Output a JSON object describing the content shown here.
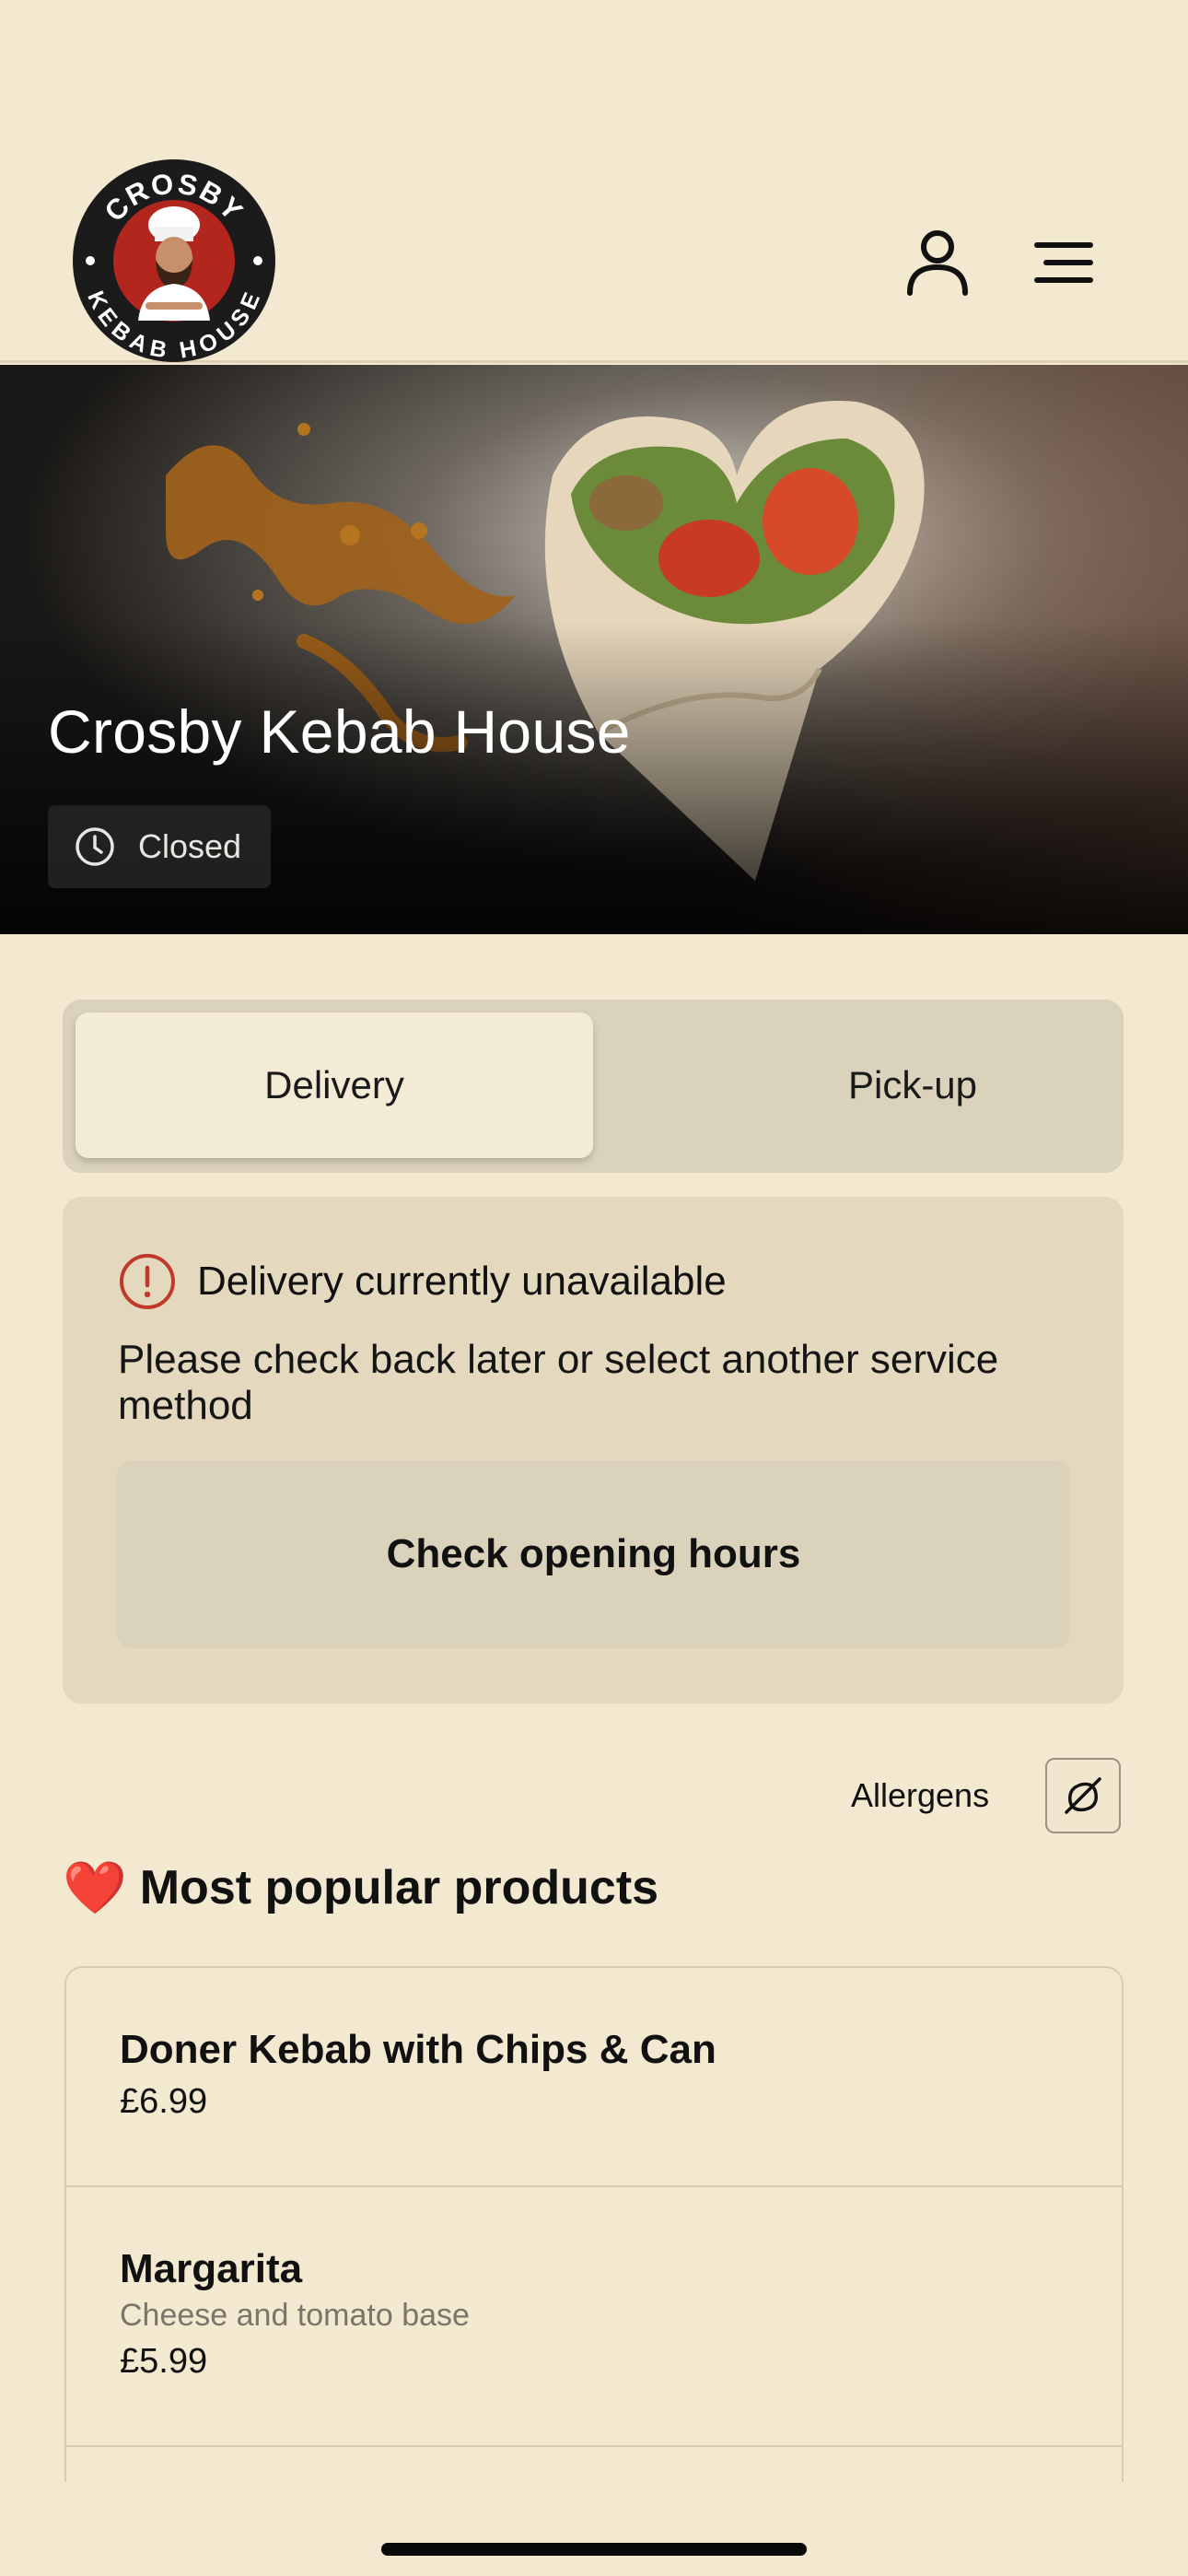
{
  "header": {
    "logo_text_top": "CROSBY",
    "logo_text_bottom": "KEBAB HOUSE",
    "icons": {
      "account": "user-icon",
      "menu": "hamburger-menu-icon"
    }
  },
  "hero": {
    "title": "Crosby Kebab House",
    "status": "Closed",
    "status_icon": "clock-icon"
  },
  "service": {
    "options": [
      "Delivery",
      "Pick-up"
    ],
    "selected": "Delivery"
  },
  "notice": {
    "icon": "info-circle-icon",
    "title": "Delivery currently unavailable",
    "message": "Please check back later or select another service method",
    "button_label": "Check opening hours"
  },
  "allergens": {
    "label": "Allergens",
    "icon": "allergen-icon"
  },
  "popular": {
    "emoji": "❤️",
    "title": "Most popular products",
    "products": [
      {
        "name": "Doner Kebab with Chips & Can",
        "description": "",
        "price": "£6.99"
      },
      {
        "name": "Margarita",
        "description": "Cheese and tomato base",
        "price": "£5.99"
      }
    ]
  },
  "colors": {
    "background": "#f3e9d1",
    "toggle_bg": "#dbd2bb",
    "card_bg": "#e4d9bf",
    "info_red": "#c0392b",
    "logo_red": "#b3261e"
  }
}
